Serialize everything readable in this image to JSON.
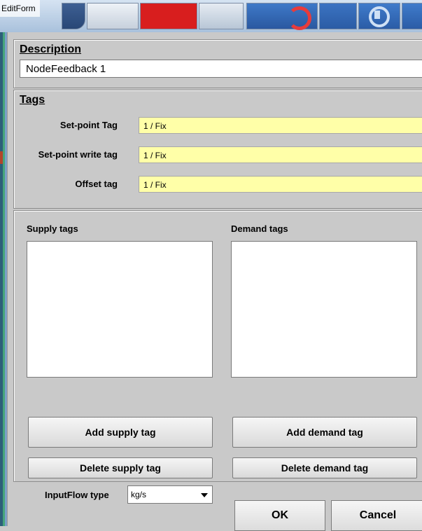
{
  "window": {
    "title": "EditForm"
  },
  "description": {
    "heading": "Description",
    "value": "NodeFeedback 1"
  },
  "tags": {
    "heading": "Tags",
    "fields": [
      {
        "label": "Set-point Tag",
        "value": "1 / Fix"
      },
      {
        "label": "Set-point write tag",
        "value": "1 / Fix"
      },
      {
        "label": "Offset tag",
        "value": "1 / Fix"
      }
    ],
    "field_color": "#ffffa8"
  },
  "supply": {
    "label": "Supply tags",
    "add_button": "Add supply tag",
    "delete_button": "Delete supply tag"
  },
  "demand": {
    "label": "Demand tags",
    "add_button": "Add demand tag",
    "delete_button": "Delete demand tag"
  },
  "inputflow": {
    "label": "InputFlow type",
    "selected": "kg/s"
  },
  "footer": {
    "ok": "OK",
    "cancel": "Cancel"
  },
  "icons": [
    "chevron-down-icon"
  ]
}
